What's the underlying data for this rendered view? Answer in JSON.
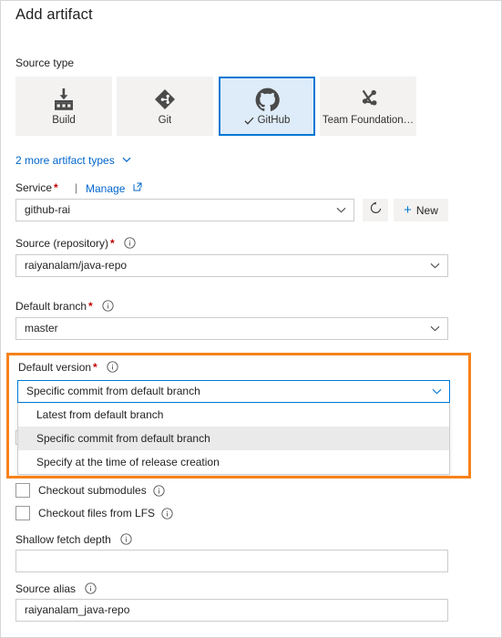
{
  "dialog": {
    "title": "Add artifact"
  },
  "source_type": {
    "label": "Source type",
    "tiles": [
      {
        "label": "Build",
        "icon": "build-icon",
        "selected": false
      },
      {
        "label": "Git",
        "icon": "git-icon",
        "selected": false
      },
      {
        "label": "GitHub",
        "icon": "github-icon",
        "selected": true
      },
      {
        "label": "Team Foundation…",
        "icon": "team-foundation-icon",
        "selected": false
      }
    ],
    "more_link": "2 more artifact types"
  },
  "service": {
    "label": "Service",
    "required_marker": "*",
    "separator": "|",
    "manage_link": "Manage",
    "value": "github-rai",
    "refresh_title": "refresh-icon",
    "new_label": "New",
    "new_plus": "+"
  },
  "source_repository": {
    "label": "Source (repository)",
    "required_marker": "*",
    "value": "raiyanalam/java-repo"
  },
  "default_branch": {
    "label": "Default branch",
    "required_marker": "*",
    "value": "master"
  },
  "default_version": {
    "label": "Default version",
    "required_marker": "*",
    "value": "Specific commit from default branch",
    "options": [
      "Latest from default branch",
      "Specific commit from default branch",
      "Specify at the time of release creation"
    ],
    "active_option_index": 1
  },
  "checkout_submodules": {
    "label": "Checkout submodules",
    "checked": false
  },
  "checkout_lfs": {
    "label": "Checkout files from LFS",
    "checked": false
  },
  "shallow_fetch_depth": {
    "label": "Shallow fetch depth",
    "value": "",
    "placeholder": ""
  },
  "source_alias": {
    "label": "Source alias",
    "value": "raiyanalam_java-repo"
  },
  "colors": {
    "accent": "#0078d4",
    "link": "#0066cc",
    "required": "#c00000",
    "highlight": "#f7821b",
    "tile_bg": "#f3f2f1",
    "tile_selected_bg": "#deecf9",
    "dropdown_active_bg": "#eaeaea",
    "text": "#252423"
  }
}
